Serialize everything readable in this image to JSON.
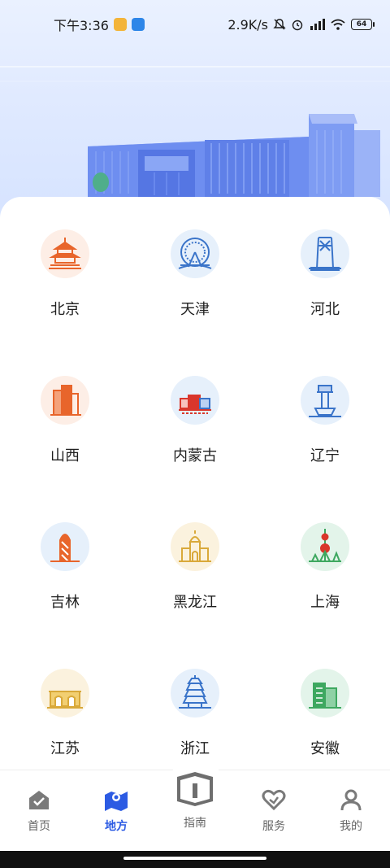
{
  "status_bar": {
    "time": "下午3:36",
    "net_speed": "2.9K/s",
    "battery": "64"
  },
  "regions": [
    {
      "name": "北京",
      "icon": "temple-of-heaven-icon",
      "color": "#e8652b"
    },
    {
      "name": "天津",
      "icon": "tianjin-eye-icon",
      "color": "#3a74c9"
    },
    {
      "name": "河北",
      "icon": "tower-icon",
      "color": "#3a74c9"
    },
    {
      "name": "山西",
      "icon": "buildings-icon",
      "color": "#e8652b"
    },
    {
      "name": "内蒙古",
      "icon": "city-scene-icon",
      "color": "#d9362b"
    },
    {
      "name": "辽宁",
      "icon": "control-tower-icon",
      "color": "#3a74c9"
    },
    {
      "name": "吉林",
      "icon": "skyscraper-icon",
      "color": "#e8652b"
    },
    {
      "name": "黑龙江",
      "icon": "cathedral-icon",
      "color": "#d9a93a"
    },
    {
      "name": "上海",
      "icon": "pearl-tower-icon",
      "color": "#3ea860"
    },
    {
      "name": "江苏",
      "icon": "gate-icon",
      "color": "#d9a93a"
    },
    {
      "name": "浙江",
      "icon": "pagoda-icon",
      "color": "#3a74c9"
    },
    {
      "name": "安徽",
      "icon": "green-building-icon",
      "color": "#3ea860"
    }
  ],
  "tabs": [
    {
      "label": "首页",
      "icon": "home-icon"
    },
    {
      "label": "地方",
      "icon": "map-icon"
    },
    {
      "label": "指南",
      "icon": "guide-book-icon"
    },
    {
      "label": "服务",
      "icon": "service-heart-icon"
    },
    {
      "label": "我的",
      "icon": "profile-icon"
    }
  ],
  "colors": {
    "accent": "#2c5be3",
    "hero_bg": "#dfe9ff",
    "building": "#6e8ef0"
  }
}
